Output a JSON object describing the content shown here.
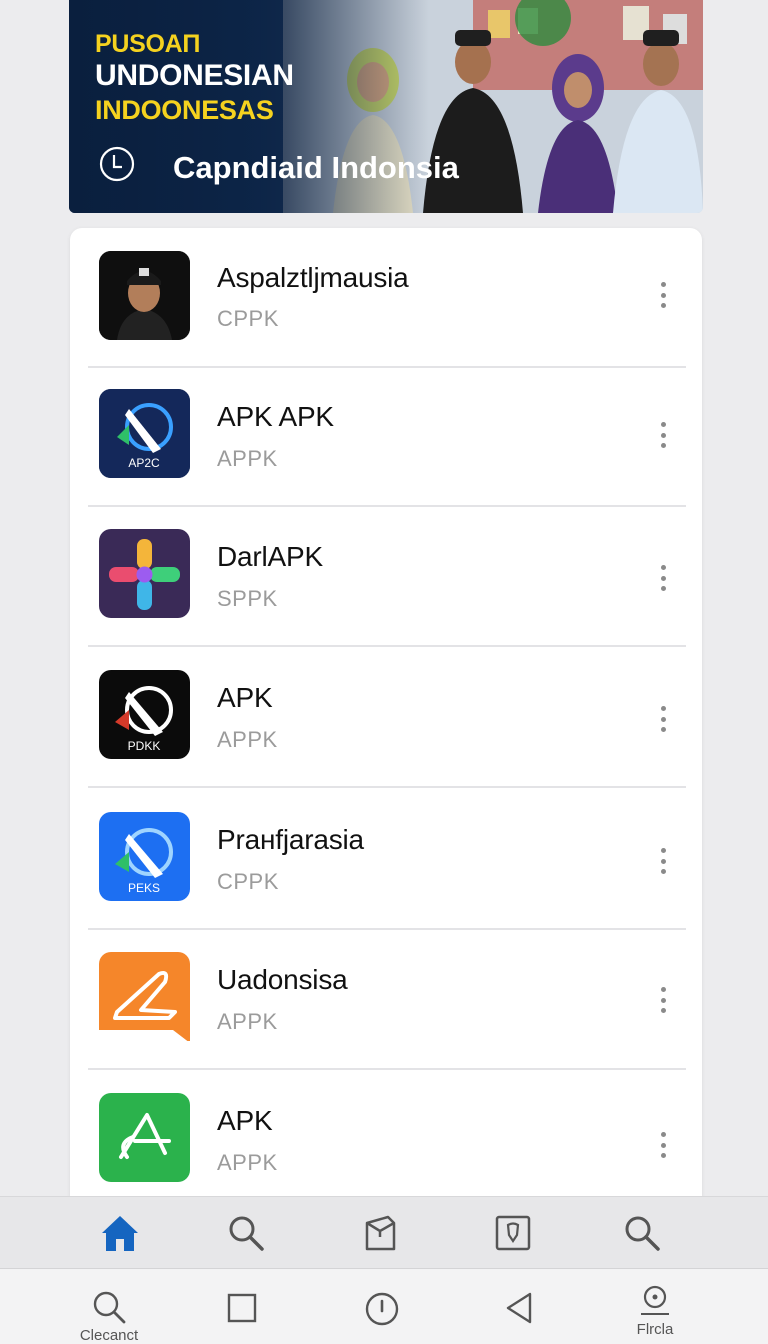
{
  "banner": {
    "title_line1": "PUSOAΠ",
    "title_line2": "UNDONESIAN",
    "title_line3": "INDOONESAS",
    "subtitle": "Capndiaid Indonsia"
  },
  "apps": [
    {
      "name": "Aspalztljmausia",
      "type": "CPPK",
      "icon": "person-avatar-icon"
    },
    {
      "name": "APK APK",
      "type": "APPK",
      "icon_label": "AP2C",
      "icon": "apk-logo-navy-icon"
    },
    {
      "name": "DarlAPK",
      "type": "SPPK",
      "icon": "colorful-flower-icon"
    },
    {
      "name": "APK",
      "type": "APPK",
      "icon_label": "PDKK",
      "icon": "apk-logo-black-icon"
    },
    {
      "name": "Praнfjarasia",
      "type": "CPPK",
      "icon_label": "PEKS",
      "icon": "apk-logo-blue-icon"
    },
    {
      "name": "Uadonsisa",
      "type": "APPK",
      "icon": "orange-plane-icon"
    },
    {
      "name": "APK",
      "type": "APPK",
      "icon": "green-apk-icon"
    }
  ],
  "tab_bar": {
    "items": [
      "home-icon",
      "search-icon",
      "package-icon",
      "shield-icon",
      "search-icon"
    ],
    "active": "home-icon",
    "active_color": "#1565c0"
  },
  "system_bar": {
    "left_label": "Clecanct",
    "right_label": "Flrcla"
  }
}
